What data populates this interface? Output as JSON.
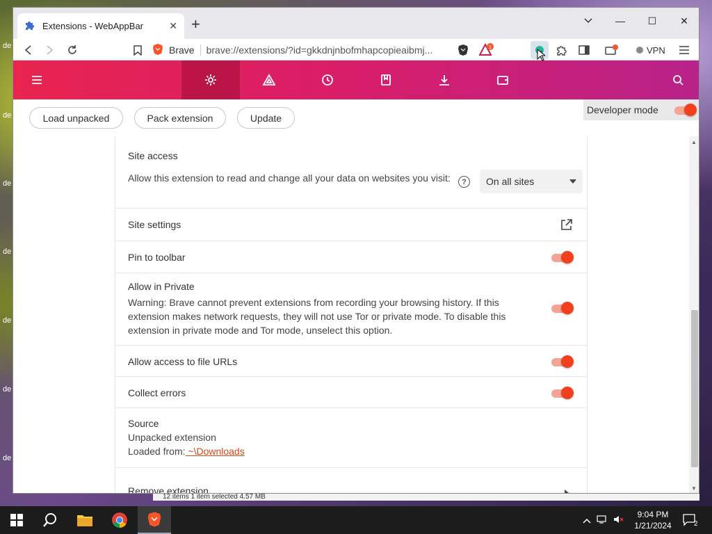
{
  "browser": {
    "tab_title": "Extensions - WebAppBar",
    "close_tab": "✕",
    "new_tab": "+",
    "window_controls": {
      "minimize": "—",
      "maximize": "☐",
      "close": "✕"
    },
    "brand_label": "Brave",
    "url": "brave://extensions/?id=gkkdnjnbofmhapcopieaibmj...",
    "vpn_label": "VPN",
    "rewards_badge": "1"
  },
  "actions": {
    "load_unpacked": "Load unpacked",
    "pack_extension": "Pack extension",
    "update": "Update",
    "developer_mode": "Developer mode",
    "developer_mode_on": true
  },
  "details": {
    "site_access": {
      "heading": "Site access",
      "description": "Allow this extension to read and change all your data on websites you visit:",
      "help": "?",
      "selected": "On all sites"
    },
    "site_settings": "Site settings",
    "pin_to_toolbar": {
      "label": "Pin to toolbar",
      "on": true
    },
    "allow_private": {
      "label": "Allow in Private",
      "warning": "Warning: Brave cannot prevent extensions from recording your browsing history. If this extension makes network requests, they will not use Tor or private mode. To disable this extension in private mode and Tor mode, unselect this option.",
      "on": true
    },
    "file_urls": {
      "label": "Allow access to file URLs",
      "on": true
    },
    "collect_errors": {
      "label": "Collect errors",
      "on": true
    },
    "source": {
      "heading": "Source",
      "type": "Unpacked extension",
      "loaded_from_label": "Loaded from:",
      "path": " ~\\Downloads"
    },
    "remove": "Remove extension"
  },
  "explorer_status": "12 items     1 item selected  4.57 MB",
  "taskbar": {
    "time": "9:04 PM",
    "date": "1/21/2024",
    "notifications": "2"
  },
  "colors": {
    "nav_gradient_start": "#e8244f",
    "nav_gradient_end": "#b8238a",
    "toggle_on": "#f23f1d",
    "link": "#d4491a"
  }
}
